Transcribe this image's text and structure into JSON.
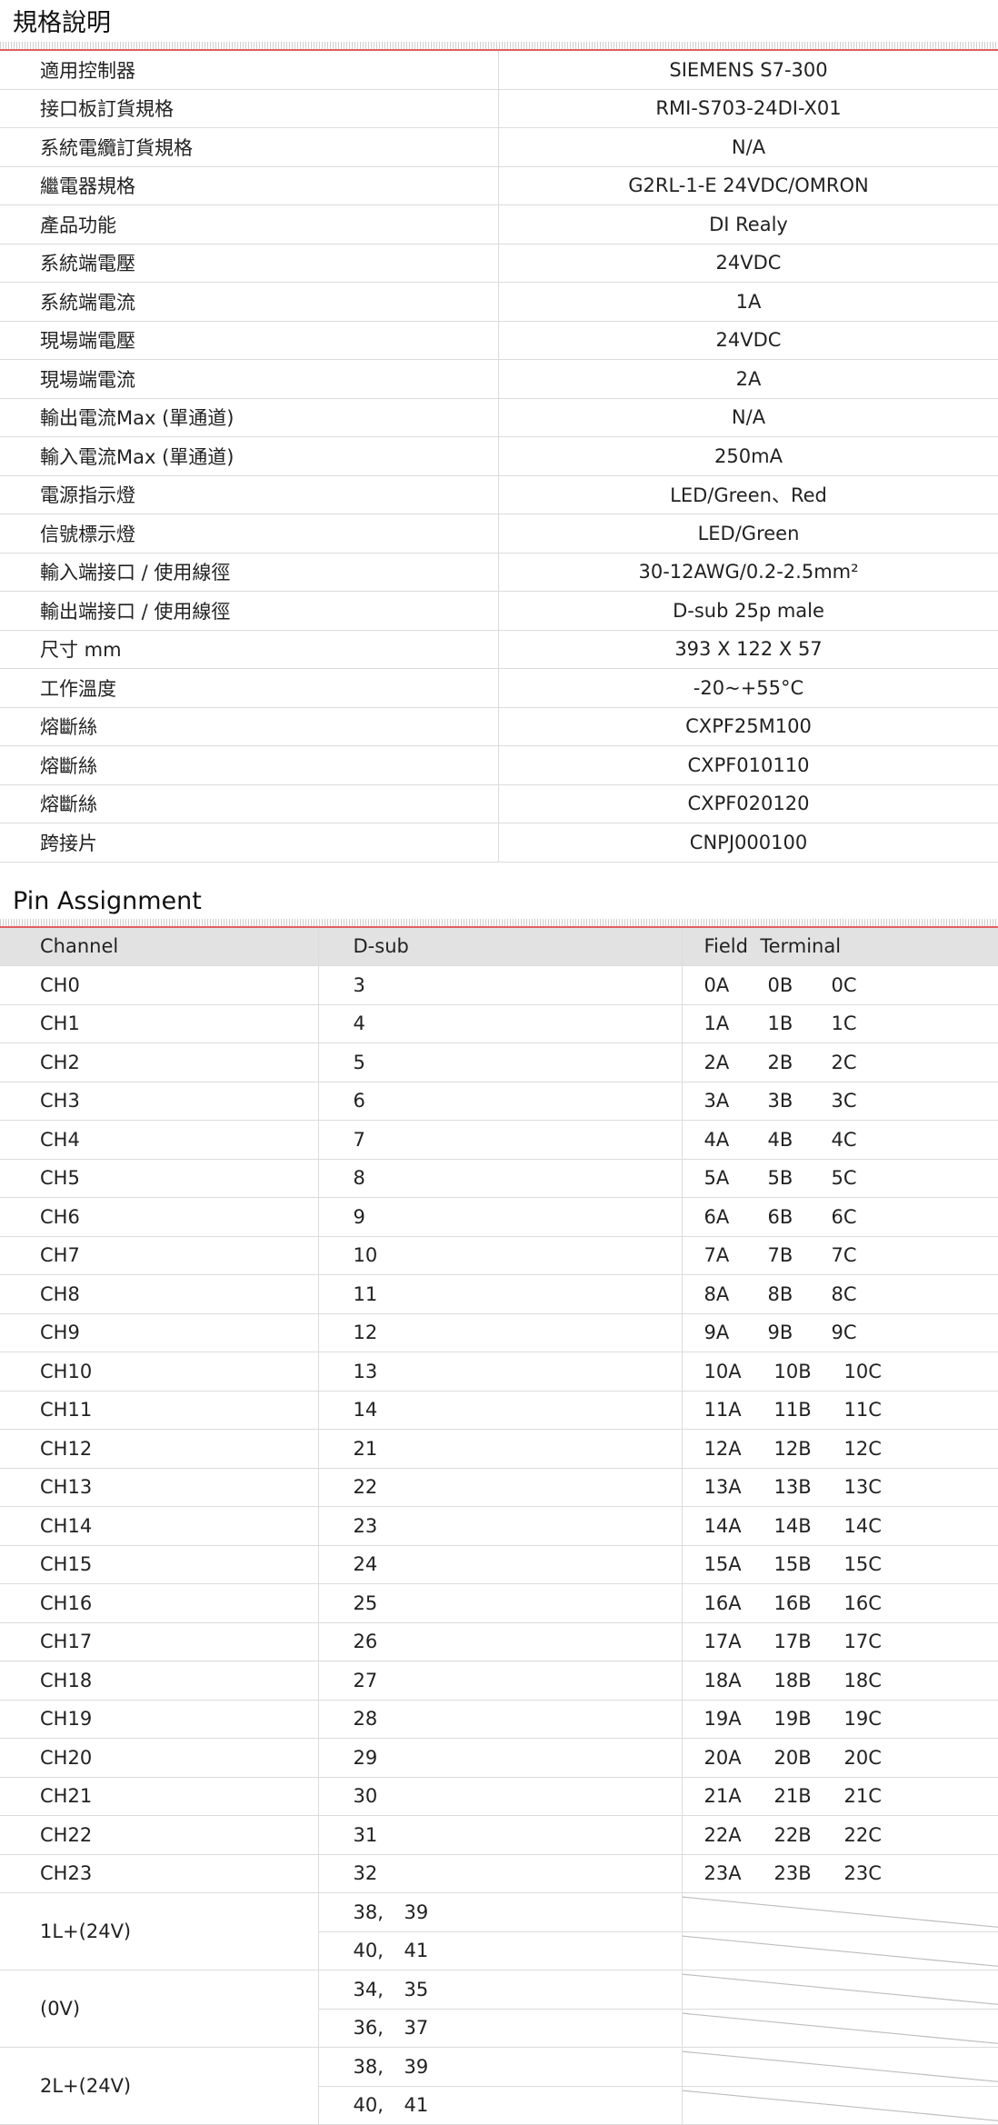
{
  "spec": {
    "title": "規格說明",
    "rows": [
      {
        "k": "適用控制器",
        "v": "SIEMENS S7-300"
      },
      {
        "k": "接口板訂貨規格",
        "v": "RMI-S703-24DI-X01"
      },
      {
        "k": "系統電纜訂貨規格",
        "v": "N/A"
      },
      {
        "k": "繼電器規格",
        "v": "G2RL-1-E 24VDC/OMRON"
      },
      {
        "k": "產品功能",
        "v": "DI Realy"
      },
      {
        "k": "系統端電壓",
        "v": "24VDC"
      },
      {
        "k": "系統端電流",
        "v": "1A"
      },
      {
        "k": "現場端電壓",
        "v": "24VDC"
      },
      {
        "k": "現場端電流",
        "v": "2A"
      },
      {
        "k": "輸出電流Max (單通道)",
        "v": "N/A"
      },
      {
        "k": "輸入電流Max (單通道)",
        "v": "250mA"
      },
      {
        "k": "電源指示燈",
        "v": "LED/Green、Red"
      },
      {
        "k": "信號標示燈",
        "v": "LED/Green"
      },
      {
        "k": "輸入端接口 / 使用線徑",
        "v": "30-12AWG/0.2-2.5mm²"
      },
      {
        "k": "輸出端接口 / 使用線徑",
        "v": "D-sub 25p male"
      },
      {
        "k": "尺寸 mm",
        "v": "393 X 122 X 57"
      },
      {
        "k": "工作溫度",
        "v": "-20~+55°C"
      },
      {
        "k": "熔斷絲",
        "v": "CXPF25M100"
      },
      {
        "k": "熔斷絲",
        "v": "CXPF010110"
      },
      {
        "k": "熔斷絲",
        "v": "CXPF020120"
      },
      {
        "k": "跨接片",
        "v": "CNPJ000100"
      }
    ]
  },
  "pin": {
    "title": "Pin Assignment",
    "headers": [
      "Channel",
      "D-sub",
      "Field  Terminal"
    ],
    "rows": [
      {
        "ch": "CH0",
        "dsub": "3",
        "ft": [
          "0A",
          "0B",
          "0C"
        ]
      },
      {
        "ch": "CH1",
        "dsub": "4",
        "ft": [
          "1A",
          "1B",
          "1C"
        ]
      },
      {
        "ch": "CH2",
        "dsub": "5",
        "ft": [
          "2A",
          "2B",
          "2C"
        ]
      },
      {
        "ch": "CH3",
        "dsub": "6",
        "ft": [
          "3A",
          "3B",
          "3C"
        ]
      },
      {
        "ch": "CH4",
        "dsub": "7",
        "ft": [
          "4A",
          "4B",
          "4C"
        ]
      },
      {
        "ch": "CH5",
        "dsub": "8",
        "ft": [
          "5A",
          "5B",
          "5C"
        ]
      },
      {
        "ch": "CH6",
        "dsub": "9",
        "ft": [
          "6A",
          "6B",
          "6C"
        ]
      },
      {
        "ch": "CH7",
        "dsub": "10",
        "ft": [
          "7A",
          "7B",
          "7C"
        ]
      },
      {
        "ch": "CH8",
        "dsub": "11",
        "ft": [
          "8A",
          "8B",
          "8C"
        ]
      },
      {
        "ch": "CH9",
        "dsub": "12",
        "ft": [
          "9A",
          "9B",
          "9C"
        ]
      },
      {
        "ch": "CH10",
        "dsub": "13",
        "ft": [
          "10A",
          "10B",
          "10C"
        ]
      },
      {
        "ch": "CH11",
        "dsub": "14",
        "ft": [
          "11A",
          "11B",
          "11C"
        ]
      },
      {
        "ch": "CH12",
        "dsub": "21",
        "ft": [
          "12A",
          "12B",
          "12C"
        ]
      },
      {
        "ch": "CH13",
        "dsub": "22",
        "ft": [
          "13A",
          "13B",
          "13C"
        ]
      },
      {
        "ch": "CH14",
        "dsub": "23",
        "ft": [
          "14A",
          "14B",
          "14C"
        ]
      },
      {
        "ch": "CH15",
        "dsub": "24",
        "ft": [
          "15A",
          "15B",
          "15C"
        ]
      },
      {
        "ch": "CH16",
        "dsub": "25",
        "ft": [
          "16A",
          "16B",
          "16C"
        ]
      },
      {
        "ch": "CH17",
        "dsub": "26",
        "ft": [
          "17A",
          "17B",
          "17C"
        ]
      },
      {
        "ch": "CH18",
        "dsub": "27",
        "ft": [
          "18A",
          "18B",
          "18C"
        ]
      },
      {
        "ch": "CH19",
        "dsub": "28",
        "ft": [
          "19A",
          "19B",
          "19C"
        ]
      },
      {
        "ch": "CH20",
        "dsub": "29",
        "ft": [
          "20A",
          "20B",
          "20C"
        ]
      },
      {
        "ch": "CH21",
        "dsub": "30",
        "ft": [
          "21A",
          "21B",
          "21C"
        ]
      },
      {
        "ch": "CH22",
        "dsub": "31",
        "ft": [
          "22A",
          "22B",
          "22C"
        ]
      },
      {
        "ch": "CH23",
        "dsub": "32",
        "ft": [
          "23A",
          "23B",
          "23C"
        ]
      }
    ],
    "power": [
      {
        "label": "1L+(24V)",
        "pins": [
          [
            "38,",
            "39"
          ],
          [
            "40,",
            "41"
          ]
        ]
      },
      {
        "label": "(0V)",
        "pins": [
          [
            "34,",
            "35"
          ],
          [
            "36,",
            "37"
          ]
        ]
      },
      {
        "label": "2L+(24V)",
        "pins": [
          [
            "38,",
            "39"
          ],
          [
            "40,",
            "41"
          ]
        ]
      }
    ]
  }
}
